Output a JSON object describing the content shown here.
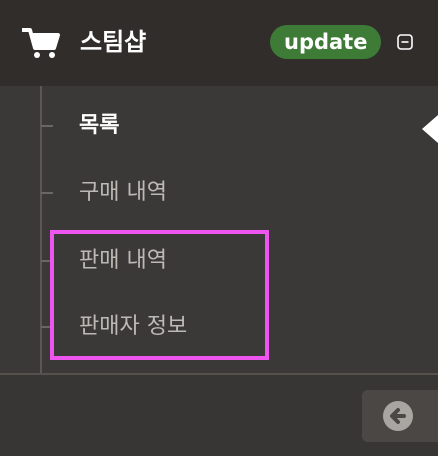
{
  "header": {
    "title": "스팀샵",
    "badge": "update",
    "cart_icon": "cart-icon",
    "collapse_icon": "collapse-minus-icon"
  },
  "menu": {
    "items": [
      {
        "label": "목록",
        "active": true
      },
      {
        "label": "구매 내역",
        "active": false
      },
      {
        "label": "판매 내역",
        "active": false
      },
      {
        "label": "판매자 정보",
        "active": false
      }
    ]
  },
  "footer": {
    "back_icon": "arrow-left-circle-icon"
  },
  "colors": {
    "header_bg": "#302d2b",
    "menu_bg": "#3b3937",
    "badge_bg": "#3e7b37",
    "highlight": "#ee55ee",
    "active_text": "#ffffff",
    "inactive_text": "#bdbab6"
  }
}
